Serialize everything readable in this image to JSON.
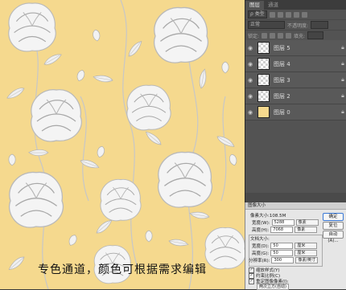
{
  "canvas": {
    "caption": "专色通道，颜色可根据需求编辑",
    "background_color": "#f5d98e",
    "flower_color": "#f2f2f2"
  },
  "panel": {
    "tabs": [
      "图层",
      "通道"
    ],
    "kind_label": "类型",
    "blend_mode": "正常",
    "opacity_label": "不透明度:",
    "lock_label": "锁定:",
    "fill_label": "填充:",
    "layers": [
      {
        "name": "图层 5",
        "thumb": "transparent"
      },
      {
        "name": "图层 4",
        "thumb": "transparent"
      },
      {
        "name": "图层 3",
        "thumb": "transparent"
      },
      {
        "name": "图层 2",
        "thumb": "transparent"
      },
      {
        "name": "图层 0",
        "thumb": "fill"
      }
    ],
    "icons": [
      "eye-icon",
      "lock-icon"
    ]
  },
  "dialog": {
    "title": "图像大小",
    "pixel_size_label": "像素大小:108.5M",
    "width_label": "宽度(W):",
    "width_value": "5288",
    "height_label": "高度(H):",
    "height_value": "7068",
    "unit_pixels": "像素",
    "doc_size_label": "文档大小:",
    "doc_width_label": "宽度(D):",
    "doc_width_value": "50",
    "doc_height_label": "高度(G):",
    "doc_height_value": "50",
    "resolution_label": "分辨率(R):",
    "resolution_value": "300",
    "unit_cm": "厘米",
    "unit_ppi": "像素/英寸",
    "scale_styles": "缩放样式(Y)",
    "constrain": "约束比例(C)",
    "resample": "重定图像像素(I):",
    "resample_method": "两次立方(自动)",
    "ok": "确定",
    "cancel": "复位",
    "auto": "自动(A)..."
  }
}
